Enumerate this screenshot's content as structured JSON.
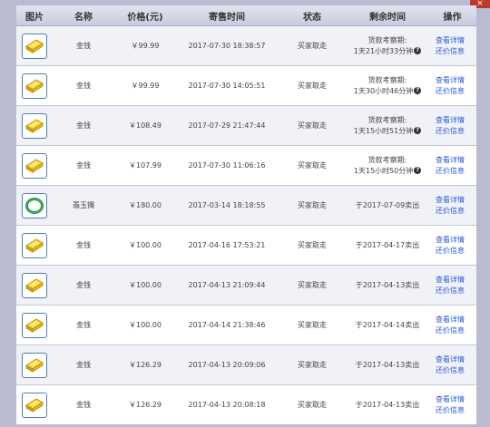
{
  "columns": [
    "图片",
    "名称",
    "价格(元)",
    "寄售时间",
    "状态",
    "剩余时间",
    "操作"
  ],
  "rows": [
    {
      "icon": "gold-bar-icon",
      "name": "金钱",
      "price": "￥99.99",
      "price_color": "black",
      "time": "2017-07-30 18:38:57",
      "status": "买家取走",
      "remain_label": "货款考察期:",
      "remain": "1天21小时33分钟",
      "ops": [
        "查看详情",
        "还价信息"
      ]
    },
    {
      "icon": "gold-bar-icon",
      "name": "金钱",
      "price": "￥99.99",
      "price_color": "black",
      "time": "2017-07-30 14:05:51",
      "status": "买家取走",
      "remain_label": "货款考察期:",
      "remain": "1天30小时46分钟",
      "ops": [
        "查看详情",
        "还价信息"
      ]
    },
    {
      "icon": "gold-bar-icon",
      "name": "金钱",
      "price": "￥108.49",
      "price_color": "blue",
      "time": "2017-07-29 21:47:44",
      "status": "买家取走",
      "remain_label": "货款考察期:",
      "remain": "1天15小时51分钟",
      "ops": [
        "查看详情",
        "还价信息"
      ]
    },
    {
      "icon": "gold-bar-icon",
      "name": "金钱",
      "price": "￥107.99",
      "price_color": "blue",
      "time": "2017-07-30 11:06:16",
      "status": "买家取走",
      "remain_label": "货款考察期:",
      "remain": "1天15小时50分钟",
      "ops": [
        "查看详情",
        "还价信息"
      ]
    },
    {
      "icon": "jade-bracelet-icon",
      "name": "翡玉镯",
      "price": "￥180.00",
      "price_color": "blue",
      "time": "2017-03-14 18:18:55",
      "status": "买家取走",
      "remain_label": "",
      "remain": "于2017-07-09卖出",
      "ops": [
        "查看详情",
        "还价信息"
      ]
    },
    {
      "icon": "gold-bar-icon",
      "name": "金钱",
      "price": "￥100.00",
      "price_color": "blue",
      "time": "2017-04-16 17:53:21",
      "status": "买家取走",
      "remain_label": "",
      "remain": "于2017-04-17卖出",
      "ops": [
        "查看详情",
        "还价信息"
      ]
    },
    {
      "icon": "gold-bar-icon",
      "name": "金钱",
      "price": "￥100.00",
      "price_color": "blue",
      "time": "2017-04-13 21:09:44",
      "status": "买家取走",
      "remain_label": "",
      "remain": "于2017-04-13卖出",
      "ops": [
        "查看详情",
        "还价信息"
      ]
    },
    {
      "icon": "gold-bar-icon",
      "name": "金钱",
      "price": "￥100.00",
      "price_color": "blue",
      "time": "2017-04-14 21:38:46",
      "status": "买家取走",
      "remain_label": "",
      "remain": "于2017-04-14卖出",
      "ops": [
        "查看详情",
        "还价信息"
      ]
    },
    {
      "icon": "gold-bar-icon",
      "name": "金钱",
      "price": "￥126.29",
      "price_color": "blue",
      "time": "2017-04-13 20:09:06",
      "status": "买家取走",
      "remain_label": "",
      "remain": "于2017-04-13卖出",
      "ops": [
        "查看详情",
        "还价信息"
      ]
    },
    {
      "icon": "gold-bar-icon",
      "name": "金钱",
      "price": "￥126.29",
      "price_color": "blue",
      "time": "2017-04-13 20:08:18",
      "status": "买家取走",
      "remain_label": "",
      "remain": "于2017-04-13卖出",
      "ops": [
        "查看详情",
        "还价信息"
      ]
    }
  ],
  "colors": {
    "price_blue": "#2a3bd0",
    "link_blue": "#2a5ad6",
    "header_bg": "#c8cbdd",
    "page_bg": "#b9bcd0"
  }
}
